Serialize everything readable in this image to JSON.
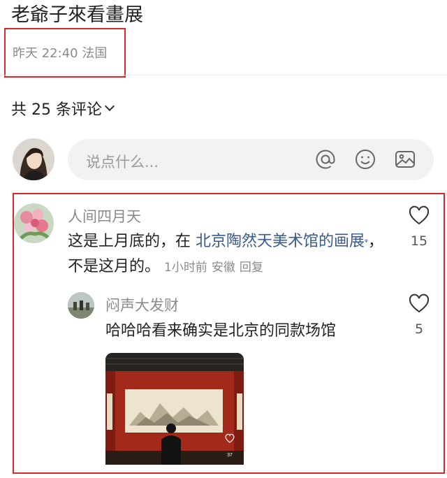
{
  "post": {
    "title": "老爺子來看畫展",
    "meta": "昨天 22:40 法国"
  },
  "comments_header": {
    "count_label": "共 25 条评论"
  },
  "composer": {
    "placeholder": "说点什么..."
  },
  "comment": {
    "user": "人间四月天",
    "text_before": "这是上月底的，在 ",
    "link": "北京陶然天美术馆的画展",
    "text_after": "，不是这月的。",
    "time": "1小时前",
    "location": "安徽",
    "reply_label": "回复",
    "likes": "15"
  },
  "reply": {
    "user": "闷声大发财",
    "text": "哈哈哈看来确实是北京的同款场馆",
    "likes": "5",
    "photo_likes": "37"
  },
  "colors": {
    "highlight_border": "#d42a2a",
    "link": "#3a5a8c",
    "muted": "#8a8a8a"
  },
  "icons": [
    "chevron-down-icon",
    "at-icon",
    "emoji-icon",
    "image-icon",
    "heart-icon"
  ]
}
